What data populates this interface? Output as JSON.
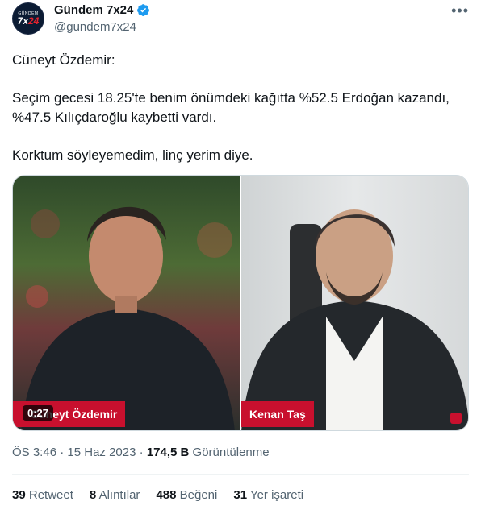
{
  "author": {
    "display_name": "Gündem 7x24",
    "handle": "@gundem7x24",
    "avatar_top": "GÜNDEM",
    "avatar_main_a": "7x",
    "avatar_main_b": "24"
  },
  "tweet": {
    "line1": "Cüneyt Özdemir:",
    "line2": "Seçim gecesi 18.25'te benim önümdeki kağıtta %52.5 Erdoğan kazandı, %47.5 Kılıçdaroğlu kaybetti vardı.",
    "line3": "Korktum söyleyemedim, linç yerim diye."
  },
  "media": {
    "left_tag": "Cüneyt Özdemir",
    "right_tag": "Kenan Taş",
    "duration": "0:27"
  },
  "meta": {
    "time": "ÖS 3:46",
    "sep": "·",
    "date": "15 Haz 2023",
    "views_count": "174,5 B",
    "views_label": "Görüntülenme"
  },
  "stats": [
    {
      "count": "39",
      "label": "Retweet"
    },
    {
      "count": "8",
      "label": "Alıntılar"
    },
    {
      "count": "488",
      "label": "Beğeni"
    },
    {
      "count": "31",
      "label": "Yer işareti"
    }
  ],
  "colors": {
    "verified": "#1d9bf0",
    "tag_red": "#c8102e",
    "muted": "#536471"
  }
}
